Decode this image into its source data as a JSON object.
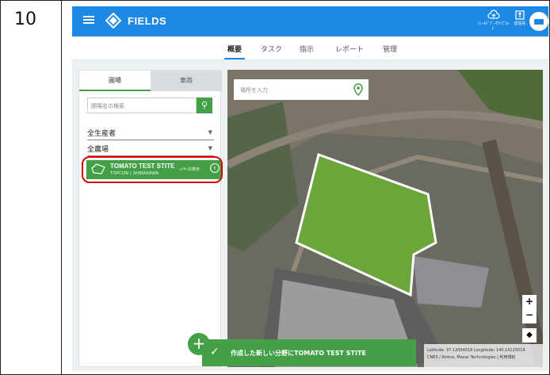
{
  "step": {
    "number": "10"
  },
  "app": {
    "title": "FIELDS",
    "brand_color": "#1e88e5",
    "accent_color": "#43a047"
  },
  "toolbar": {
    "cloud_label": "ﾌｨｰﾙﾄﾞﾃﾞｰﾀｱｯﾌﾟﾛｰﾄﾞ",
    "cloud_icon": "cloud-upload-icon",
    "export_label": "送信先",
    "export_icon": "upload-box-icon",
    "avatar_icon": "user-avatar-icon"
  },
  "nav": {
    "tabs": [
      {
        "label": "概要",
        "active": true
      },
      {
        "label": "タスク"
      },
      {
        "label": "指示"
      },
      {
        "label": "レポート"
      },
      {
        "label": "管理"
      }
    ]
  },
  "panel": {
    "tabs": [
      {
        "label": "圃場",
        "active": true
      },
      {
        "label": "車両"
      }
    ],
    "search_placeholder": "圃場名の検索",
    "grower_select": "全生産者",
    "farm_select": "全農場",
    "field_item": {
      "name": "TOMATO TEST STITE",
      "sub": "TOPCON | SHIRAKAWA",
      "show_label": "ﾚｲﾔｰの表示"
    }
  },
  "map": {
    "search_placeholder": "場所を入力",
    "zoom_in": "+",
    "zoom_out": "−",
    "attribution_line1": "Latitude: 37.12004018  Longitude: 140.14125019",
    "attribution_line2": "CNES / Airbus, Maxar Technologies | 利用規約"
  },
  "toast": {
    "message": "作成した新しい分野にTOMATO TEST STITE"
  },
  "fab": {
    "label": "+"
  }
}
